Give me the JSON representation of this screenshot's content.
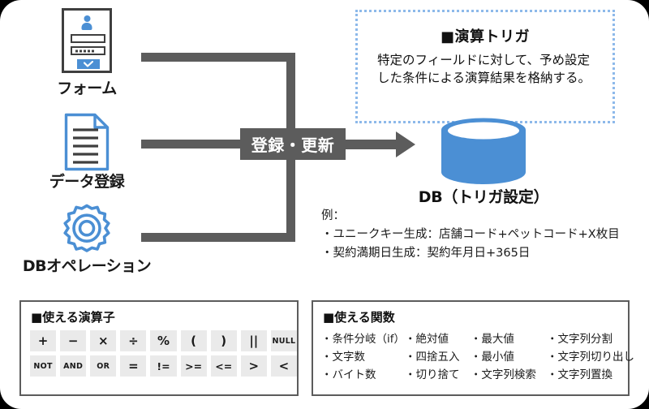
{
  "sources": [
    {
      "id": "form",
      "label": "フォーム",
      "icon": "form-icon"
    },
    {
      "id": "data-entry",
      "label": "データ登録",
      "icon": "document-icon"
    },
    {
      "id": "db-operation",
      "label": "DBオペレーション",
      "icon": "gear-icon"
    }
  ],
  "flow": {
    "action_label": "登録・更新",
    "arrow": "arrow-right-icon"
  },
  "trigger_callout": {
    "title": "■演算トリガ",
    "body": "特定のフィールドに対して、予め設定した条件による演算結果を格納する。"
  },
  "database": {
    "icon": "database-cylinder-icon",
    "label": "DB（トリガ設定）"
  },
  "examples": {
    "heading": "例：",
    "items": [
      "・ユニークキー生成：店舗コード+ペットコード+X枚目",
      "・契約満期日生成：契約年月日+365日"
    ]
  },
  "operators_panel": {
    "title": "■使える演算子",
    "rows": [
      [
        "+",
        "−",
        "×",
        "÷",
        "%",
        "(",
        ")",
        "||",
        "NULL"
      ],
      [
        "NOT",
        "AND",
        "OR",
        "=",
        "!=",
        ">=",
        "<=",
        ">",
        "<"
      ]
    ]
  },
  "functions_panel": {
    "title": "■使える関数",
    "columns": [
      [
        "・条件分岐（if）",
        "・文字数",
        "・バイト数"
      ],
      [
        "・絶対値",
        "・四捨五入",
        "・切り捨て"
      ],
      [
        "・最大値",
        "・最小値",
        "・文字列検索"
      ],
      [
        "・文字列分割",
        "・文字列切り出し",
        "・文字列置換"
      ]
    ]
  },
  "colors": {
    "accent_blue": "#4b8fd4",
    "dashed_blue": "#8db9ea",
    "line_gray": "#5c5c5c",
    "cell_gray": "#eaeaea",
    "text_dark": "#1a1a1a"
  }
}
